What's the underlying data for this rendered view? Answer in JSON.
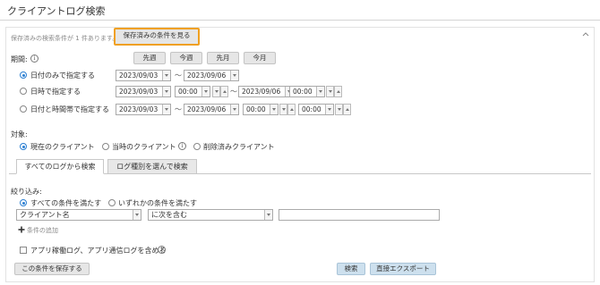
{
  "header": {
    "title": "クライアントログ検索"
  },
  "saved": {
    "message": "保存済みの検索条件が 1 件あります。",
    "show_button": "保存済みの条件を見る",
    "collapse_icon": "chevron-up-icon"
  },
  "period": {
    "label": "期間:",
    "info_icon": "info-icon",
    "quick_buttons": [
      "先週",
      "今週",
      "先月",
      "今月"
    ],
    "options": [
      {
        "label": "日付のみで指定する",
        "selected": true
      },
      {
        "label": "日時で指定する",
        "selected": false
      },
      {
        "label": "日付と時間帯で指定する",
        "selected": false
      }
    ],
    "from_date": "2023/09/03",
    "to_date": "2023/09/06",
    "time_value": "00:00",
    "tilde": "〜"
  },
  "target": {
    "label": "対象:",
    "options": [
      {
        "label": "現在のクライアント",
        "selected": true
      },
      {
        "label": "当時のクライアント",
        "selected": false
      },
      {
        "label": "削除済みクライアント",
        "selected": false
      }
    ]
  },
  "tabs": [
    {
      "label": "すべてのログから検索",
      "active": true
    },
    {
      "label": "ログ種別を選んで検索",
      "active": false
    }
  ],
  "filter": {
    "label": "絞り込み:",
    "match_options": [
      {
        "label": "すべての条件を満たす",
        "selected": true
      },
      {
        "label": "いずれかの条件を満たす",
        "selected": false
      }
    ],
    "field_value": "クライアント名",
    "operator_value": "に次を含む",
    "text_value": "",
    "add_condition": "条件の追加",
    "include_label": "アプリ稼働ログ、アプリ通信ログを含める"
  },
  "footer": {
    "save_button": "この条件を保存する",
    "search_button": "検索",
    "export_button": "直接エクスポート"
  }
}
